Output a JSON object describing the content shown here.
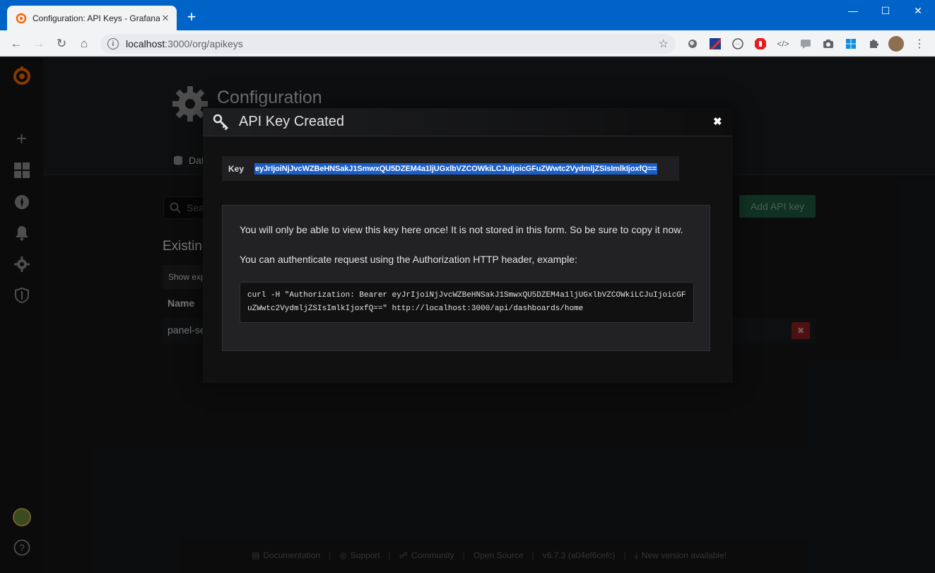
{
  "browser": {
    "tab_title": "Configuration: API Keys - Grafana",
    "url_host": "localhost",
    "url_rest": ":3000/org/apikeys"
  },
  "grafana": {
    "page_title": "Configuration",
    "tab_datasources": "Dat",
    "search_placeholder": "Sea",
    "add_button": "Add API key",
    "existing_heading": "Existing",
    "show_expired": "Show exp",
    "name_header": "Name",
    "row_name": "panel-se",
    "footer": {
      "documentation": "Documentation",
      "support": "Support",
      "community": "Community",
      "open_source": "Open Source",
      "version": "v6.7.3 (a04ef6cefc)",
      "new_version": "New version available!"
    }
  },
  "modal": {
    "title": "API Key Created",
    "key_label": "Key",
    "key_value": "eyJrIjoiNjJvcWZBeHNSakJ1SmwxQU5DZEM4a1ljUGxlbVZCOWkiLCJuIjoicGFuZWwtc2VydmljZSIsImlkIjoxfQ==",
    "info_once": "You will only be able to view this key here once! It is not stored in this form. So be sure to copy it now.",
    "info_auth": "You can authenticate request using the Authorization HTTP header, example:",
    "curl_example": "curl -H \"Authorization: Bearer eyJrIjoiNjJvcWZBeHNSakJ1SmwxQU5DZEM4a1ljUGxlbVZCOWkiLCJuIjoicGFuZWwtc2VydmljZSIsImlkIjoxfQ==\" http://localhost:3000/api/dashboards/home"
  },
  "colors": {
    "chrome_blue": "#0063c7",
    "grafana_green": "#21724b",
    "selection_blue": "#1a5ec9",
    "delete_red": "#8a1f1f"
  }
}
